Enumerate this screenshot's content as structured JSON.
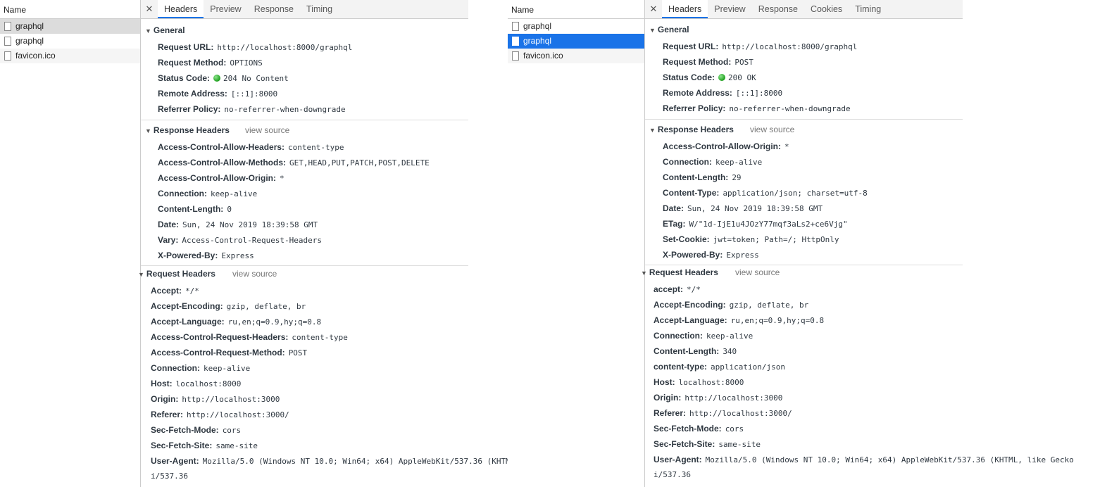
{
  "left": {
    "list_header": "Name",
    "files": [
      {
        "name": "graphql"
      },
      {
        "name": "graphql"
      },
      {
        "name": "favicon.ico"
      }
    ],
    "tabs": [
      "Headers",
      "Preview",
      "Response",
      "Timing"
    ],
    "general_title": "General",
    "general": [
      {
        "key": "Request URL:",
        "value": "http://localhost:8000/graphql"
      },
      {
        "key": "Request Method:",
        "value": "OPTIONS"
      },
      {
        "key": "Status Code:",
        "value": "204 No Content"
      },
      {
        "key": "Remote Address:",
        "value": "[::1]:8000"
      },
      {
        "key": "Referrer Policy:",
        "value": "no-referrer-when-downgrade"
      }
    ],
    "response_title": "Response Headers",
    "response_view_source": "view source",
    "response_headers": [
      {
        "key": "Access-Control-Allow-Headers:",
        "value": "content-type"
      },
      {
        "key": "Access-Control-Allow-Methods:",
        "value": "GET,HEAD,PUT,PATCH,POST,DELETE"
      },
      {
        "key": "Access-Control-Allow-Origin:",
        "value": "*"
      },
      {
        "key": "Connection:",
        "value": "keep-alive"
      },
      {
        "key": "Content-Length:",
        "value": "0"
      },
      {
        "key": "Date:",
        "value": "Sun, 24 Nov 2019 18:39:58 GMT"
      },
      {
        "key": "Vary:",
        "value": "Access-Control-Request-Headers"
      },
      {
        "key": "X-Powered-By:",
        "value": "Express"
      }
    ],
    "request_title": "Request Headers",
    "request_view_source": "view source",
    "request_headers": [
      {
        "key": "Accept:",
        "value": "*/*"
      },
      {
        "key": "Accept-Encoding:",
        "value": "gzip, deflate, br"
      },
      {
        "key": "Accept-Language:",
        "value": "ru,en;q=0.9,hy;q=0.8"
      },
      {
        "key": "Access-Control-Request-Headers:",
        "value": "content-type"
      },
      {
        "key": "Access-Control-Request-Method:",
        "value": "POST"
      },
      {
        "key": "Connection:",
        "value": "keep-alive"
      },
      {
        "key": "Host:",
        "value": "localhost:8000"
      },
      {
        "key": "Origin:",
        "value": "http://localhost:3000"
      },
      {
        "key": "Referer:",
        "value": "http://localhost:3000/"
      },
      {
        "key": "Sec-Fetch-Mode:",
        "value": "cors"
      },
      {
        "key": "Sec-Fetch-Site:",
        "value": "same-site"
      },
      {
        "key": "User-Agent:",
        "value": "Mozilla/5.0 (Windows NT 10.0; Win64; x64) AppleWebKit/537.36 (KHTM"
      }
    ],
    "user_agent_cont": "i/537.36"
  },
  "right": {
    "list_header": "Name",
    "files": [
      {
        "name": "graphql"
      },
      {
        "name": "graphql"
      },
      {
        "name": "favicon.ico"
      }
    ],
    "tabs": [
      "Headers",
      "Preview",
      "Response",
      "Cookies",
      "Timing"
    ],
    "general_title": "General",
    "general": [
      {
        "key": "Request URL:",
        "value": "http://localhost:8000/graphql"
      },
      {
        "key": "Request Method:",
        "value": "POST"
      },
      {
        "key": "Status Code:",
        "value": "200 OK"
      },
      {
        "key": "Remote Address:",
        "value": "[::1]:8000"
      },
      {
        "key": "Referrer Policy:",
        "value": "no-referrer-when-downgrade"
      }
    ],
    "response_title": "Response Headers",
    "response_view_source": "view source",
    "response_headers": [
      {
        "key": "Access-Control-Allow-Origin:",
        "value": "*"
      },
      {
        "key": "Connection:",
        "value": "keep-alive"
      },
      {
        "key": "Content-Length:",
        "value": "29"
      },
      {
        "key": "Content-Type:",
        "value": "application/json; charset=utf-8"
      },
      {
        "key": "Date:",
        "value": "Sun, 24 Nov 2019 18:39:58 GMT"
      },
      {
        "key": "ETag:",
        "value": "W/\"1d-IjE1u4JOzY77mqf3aLs2+ce6Vjg\""
      },
      {
        "key": "Set-Cookie:",
        "value": "jwt=token; Path=/; HttpOnly"
      },
      {
        "key": "X-Powered-By:",
        "value": "Express"
      }
    ],
    "request_title": "Request Headers",
    "request_view_source": "view source",
    "request_headers": [
      {
        "key": "accept:",
        "value": "*/*"
      },
      {
        "key": "Accept-Encoding:",
        "value": "gzip, deflate, br"
      },
      {
        "key": "Accept-Language:",
        "value": "ru,en;q=0.9,hy;q=0.8"
      },
      {
        "key": "Connection:",
        "value": "keep-alive"
      },
      {
        "key": "Content-Length:",
        "value": "340"
      },
      {
        "key": "content-type:",
        "value": "application/json"
      },
      {
        "key": "Host:",
        "value": "localhost:8000"
      },
      {
        "key": "Origin:",
        "value": "http://localhost:3000"
      },
      {
        "key": "Referer:",
        "value": "http://localhost:3000/"
      },
      {
        "key": "Sec-Fetch-Mode:",
        "value": "cors"
      },
      {
        "key": "Sec-Fetch-Site:",
        "value": "same-site"
      },
      {
        "key": "User-Agent:",
        "value": "Mozilla/5.0 (Windows NT 10.0; Win64; x64) AppleWebKit/537.36 (KHTML, like Gecko"
      }
    ],
    "user_agent_cont": "i/537.36"
  },
  "status_dot_color": "#22a822",
  "accent_color": "#1a73e8"
}
